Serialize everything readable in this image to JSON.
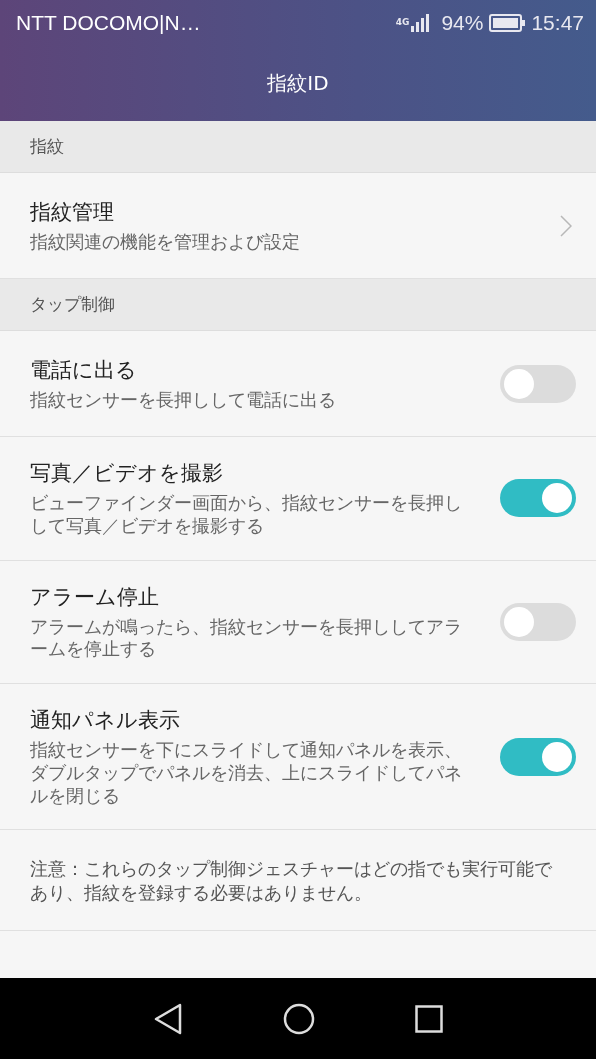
{
  "status_bar": {
    "carrier": "NTT DOCOMO|N…",
    "network": "4G",
    "battery": "94%",
    "time": "15:47"
  },
  "title": "指紋ID",
  "sections": [
    {
      "header": "指紋",
      "items": [
        {
          "kind": "link",
          "title": "指紋管理",
          "description": "指紋関連の機能を管理および設定"
        }
      ]
    },
    {
      "header": "タップ制御",
      "items": [
        {
          "kind": "toggle",
          "title": "電話に出る",
          "description": "指紋センサーを長押しして電話に出る",
          "on": false
        },
        {
          "kind": "toggle",
          "title": "写真／ビデオを撮影",
          "description": "ビューファインダー画面から、指紋センサーを長押しして写真／ビデオを撮影する",
          "on": true
        },
        {
          "kind": "toggle",
          "title": "アラーム停止",
          "description": "アラームが鳴ったら、指紋センサーを長押ししてアラームを停止する",
          "on": false
        },
        {
          "kind": "toggle",
          "title": "通知パネル表示",
          "description": "指紋センサーを下にスライドして通知パネルを表示、ダブルタップでパネルを消去、上にスライドしてパネルを閉じる",
          "on": true
        }
      ]
    }
  ],
  "note": "注意：これらのタップ制御ジェスチャーはどの指でも実行可能であり、指紋を登録する必要はありません。"
}
